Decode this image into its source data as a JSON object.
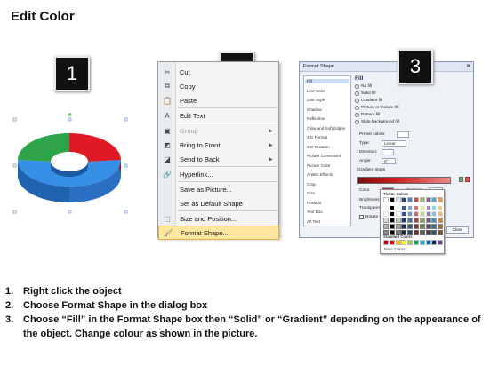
{
  "title": "Edit Color",
  "badges": [
    "1",
    "2",
    "3"
  ],
  "context_menu": {
    "items": [
      {
        "label": "Cut",
        "icon": "scissors-icon",
        "glyph": "✂",
        "submenu": false,
        "disabled": false
      },
      {
        "label": "Copy",
        "icon": "copy-icon",
        "glyph": "⧉",
        "submenu": false,
        "disabled": false
      },
      {
        "label": "Paste",
        "icon": "paste-icon",
        "glyph": "📋",
        "submenu": false,
        "disabled": false
      },
      {
        "label": "Edit Text",
        "icon": "edit-text-icon",
        "glyph": "A",
        "submenu": false,
        "disabled": false
      },
      {
        "label": "Group",
        "icon": "group-icon",
        "glyph": "▣",
        "submenu": true,
        "disabled": true
      },
      {
        "label": "Bring to Front",
        "icon": "bring-to-front-icon",
        "glyph": "◩",
        "submenu": true,
        "disabled": false
      },
      {
        "label": "Send to Back",
        "icon": "send-to-back-icon",
        "glyph": "◪",
        "submenu": true,
        "disabled": false
      },
      {
        "label": "Hyperlink...",
        "icon": "hyperlink-icon",
        "glyph": "🔗",
        "submenu": false,
        "disabled": false
      },
      {
        "label": "Save as Picture...",
        "icon": "",
        "glyph": "",
        "submenu": false,
        "disabled": false
      },
      {
        "label": "Set as Default Shape",
        "icon": "",
        "glyph": "",
        "submenu": false,
        "disabled": false
      },
      {
        "label": "Size and Position...",
        "icon": "size-position-icon",
        "glyph": "⬚",
        "submenu": false,
        "disabled": false
      },
      {
        "label": "Format Shape...",
        "icon": "format-shape-icon",
        "glyph": "🖌",
        "submenu": false,
        "disabled": false,
        "highlighted": true
      }
    ]
  },
  "dialog": {
    "title": "Format Shape",
    "close_glyph": "✕",
    "nav": [
      "Fill",
      "Line Color",
      "Line Style",
      "Shadow",
      "Reflection",
      "Glow and Soft Edges",
      "3-D Format",
      "3-D Rotation",
      "Picture Corrections",
      "Picture Color",
      "Artistic Effects",
      "Crop",
      "Size",
      "Position",
      "Text Box",
      "Alt Text"
    ],
    "section": "Fill",
    "fill_options": [
      "No fill",
      "Solid fill",
      "Gradient fill",
      "Picture or texture fill",
      "Pattern fill",
      "Slide background fill"
    ],
    "selected_fill": "Gradient fill",
    "preset_colors": "Preset colors:",
    "type_label": "Type:",
    "type_value": "Linear",
    "direction_label": "Direction:",
    "angle_label": "Angle:",
    "angle_value": "0°",
    "stops_label": "Gradient stops",
    "color_label": "Color",
    "position_label": "Position:",
    "position_value": "0%",
    "brightness_label": "Brightness:",
    "transparency_label": "Transparency:",
    "rotate_label": "Rotate with shape",
    "close_label": "Close",
    "popup_theme": "Theme Colors",
    "popup_standard": "Standard Colors",
    "popup_more": "More Colors...",
    "theme_colors": [
      "#ffffff",
      "#000000",
      "#eeece1",
      "#1f497d",
      "#4f81bd",
      "#c0504d",
      "#9bbb59",
      "#8064a2",
      "#4bacc6",
      "#f79646"
    ],
    "standard_colors": [
      "#c00000",
      "#ff0000",
      "#ffc000",
      "#ffff00",
      "#92d050",
      "#00b050",
      "#00b0f0",
      "#0070c0",
      "#002060",
      "#7030a0"
    ]
  },
  "ring_colors": {
    "green": "#2fa34a",
    "red": "#e01a24",
    "blue": "#2f7fd6"
  },
  "instructions": [
    {
      "num": "1.",
      "text": "Right click the object"
    },
    {
      "num": "2.",
      "text": "Choose Format Shape in the dialog box"
    },
    {
      "num": "3.",
      "text": "Choose “Fill” in the Format Shape box then “Solid” or “Gradient” depending on the appearance of the object. Change colour as shown in the picture."
    }
  ]
}
